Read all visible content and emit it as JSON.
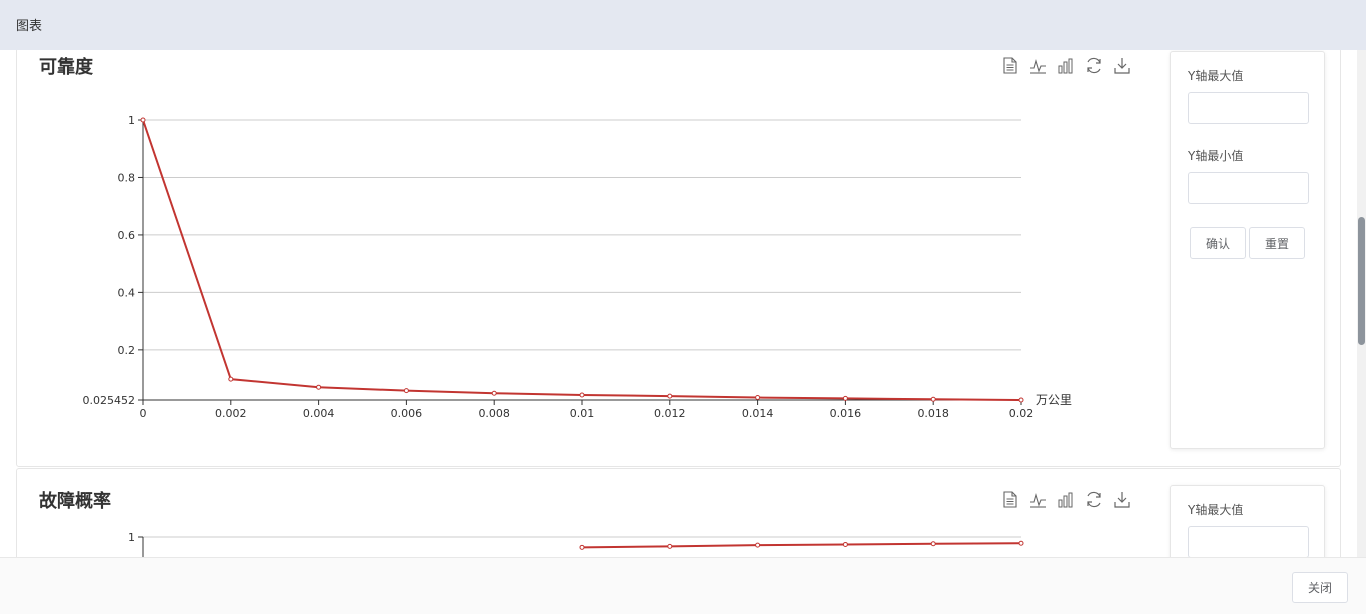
{
  "window": {
    "title": "图表"
  },
  "charts": [
    {
      "title": "可靠度",
      "settings": {
        "ymax_label": "Y轴最大值",
        "ymin_label": "Y轴最小值",
        "confirm": "确认",
        "reset": "重置"
      }
    },
    {
      "title": "故障概率",
      "settings": {
        "ymax_label": "Y轴最大值"
      }
    }
  ],
  "chart_data": [
    {
      "type": "line",
      "title": "可靠度",
      "xlabel": "万公里",
      "ylabel": "",
      "x": [
        0,
        0.002,
        0.004,
        0.006,
        0.008,
        0.01,
        0.012,
        0.014,
        0.016,
        0.018,
        0.02
      ],
      "x_ticks": [
        "0",
        "0.002",
        "0.004",
        "0.006",
        "0.008",
        "0.01",
        "0.012",
        "0.014",
        "0.016",
        "0.018",
        "0.02"
      ],
      "y_ticks": [
        "0.025452",
        "0.2",
        "0.4",
        "0.6",
        "0.8",
        "1"
      ],
      "series": [
        {
          "values": [
            1,
            0.098,
            0.07,
            0.058,
            0.049,
            0.043,
            0.039,
            0.034,
            0.031,
            0.028,
            0.0255
          ]
        }
      ],
      "xlim": [
        0,
        0.02
      ],
      "ylim": [
        0.025452,
        1
      ],
      "grid": true,
      "color": "#c23531"
    },
    {
      "type": "line",
      "title": "故障概率",
      "y_ticks": [
        "1"
      ],
      "series": [
        {
          "values": [
            null,
            null,
            null,
            null,
            null,
            0.957,
            0.961,
            0.966,
            0.969,
            0.972,
            0.974
          ]
        }
      ],
      "color": "#c23531"
    }
  ],
  "footer": {
    "close": "关闭"
  }
}
